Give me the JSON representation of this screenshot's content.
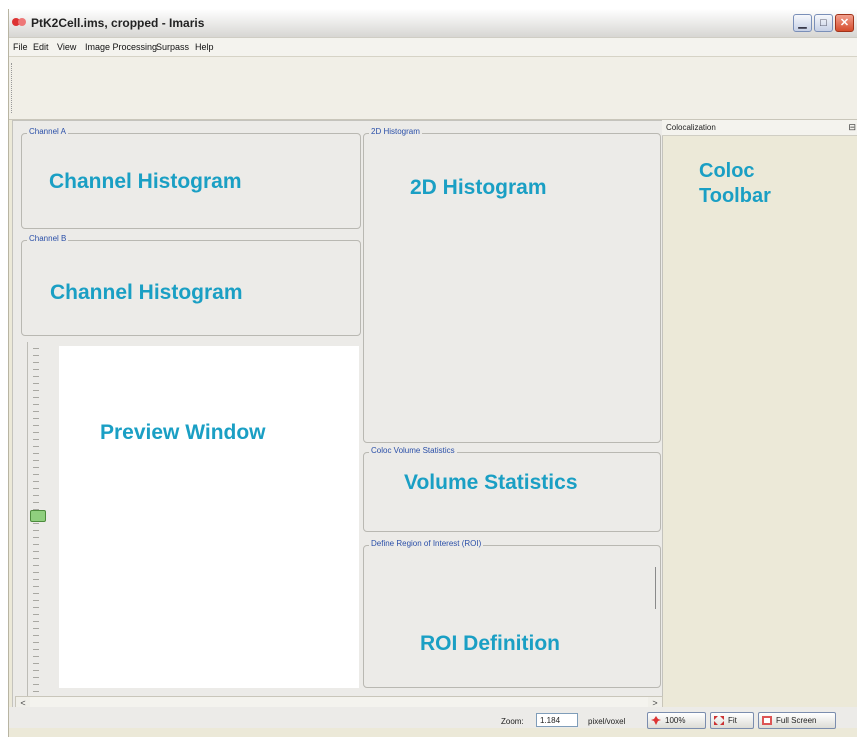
{
  "window": {
    "title": "PtK2Cell.ims, cropped  - Imaris",
    "controls": {
      "minimize": "▁",
      "maximize": "□",
      "close": "✕"
    }
  },
  "menu": [
    "File",
    "Edit",
    "View",
    "Image Processing",
    "Surpass",
    "Help"
  ],
  "panels": {
    "channel_a": {
      "legend": "Channel A",
      "label": "Channel Histogram"
    },
    "channel_b": {
      "legend": "Channel B",
      "label": "Channel Histogram"
    },
    "hist2d": {
      "legend": "2D Histogram",
      "label": "2D Histogram"
    },
    "volume_stats": {
      "legend": "Coloc Volume Statistics",
      "label": "Volume Statistics"
    },
    "roi": {
      "legend": "Define Region of Interest (ROI)",
      "label": "ROI Definition"
    },
    "preview": {
      "label": "Preview Window"
    }
  },
  "coloc": {
    "title": "Colocalization",
    "line1": "Coloc",
    "line2": "Toolbar"
  },
  "scroll": {
    "left": "<",
    "right": ">"
  },
  "status": {
    "zoom_label": "Zoom:",
    "zoom_value": "1.184",
    "unit": "pixel/voxel",
    "btn_100": "100%",
    "btn_fit": "Fit",
    "btn_full": "Full Screen"
  },
  "colors": {
    "accent": "#1a9fc4",
    "legend": "#2a4fa8",
    "close": "#d54c2c",
    "slider_handle": "#8fcf7e"
  }
}
